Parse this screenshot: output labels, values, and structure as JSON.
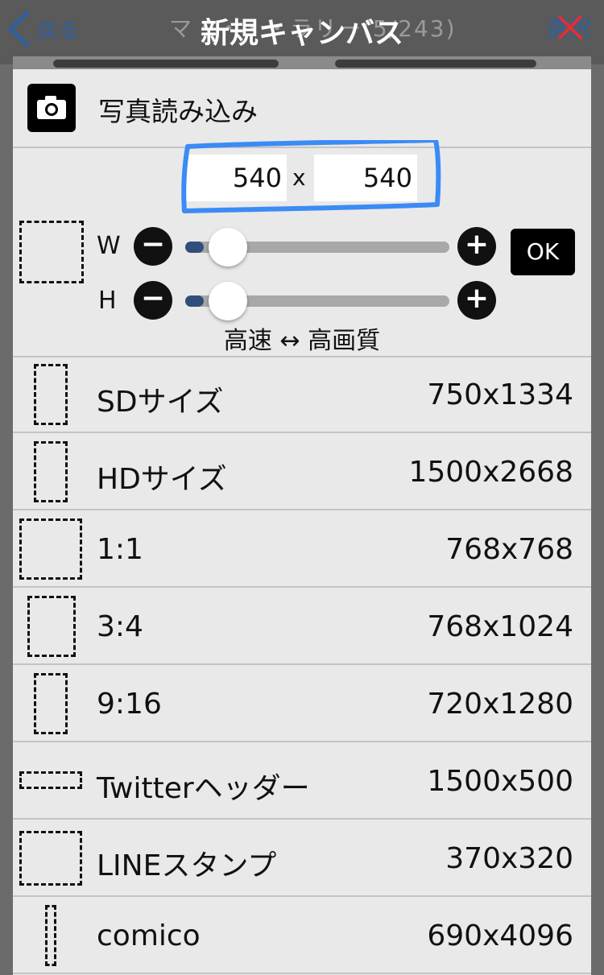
{
  "navbar": {
    "back_label": "戻る",
    "bg_title": "マ・・・・ラリー(5/243)",
    "title": "新規キャンバス",
    "select_label": "選択"
  },
  "photo_import": {
    "label": "写真読み込み",
    "icon": "camera-icon"
  },
  "custom_size": {
    "width_value": "540",
    "height_value": "540",
    "times": "x",
    "w_label": "W",
    "h_label": "H",
    "minus": "−",
    "plus": "+",
    "ok_label": "OK",
    "quality_hint": "高速 ↔ 高画質",
    "w_slider_level": 0.04,
    "h_slider_level": 0.04,
    "highlight_color": "#3a8bf5"
  },
  "presets": [
    {
      "name": "SDサイズ",
      "size": "750x1334"
    },
    {
      "name": "HDサイズ",
      "size": "1500x2668"
    },
    {
      "name": "1:1",
      "size": "768x768"
    },
    {
      "name": "3:4",
      "size": "768x1024"
    },
    {
      "name": "9:16",
      "size": "720x1280"
    },
    {
      "name": "Twitterヘッダー",
      "size": "1500x500"
    },
    {
      "name": "LINEスタンプ",
      "size": "370x320"
    },
    {
      "name": "comico",
      "size": "690x4096"
    }
  ]
}
